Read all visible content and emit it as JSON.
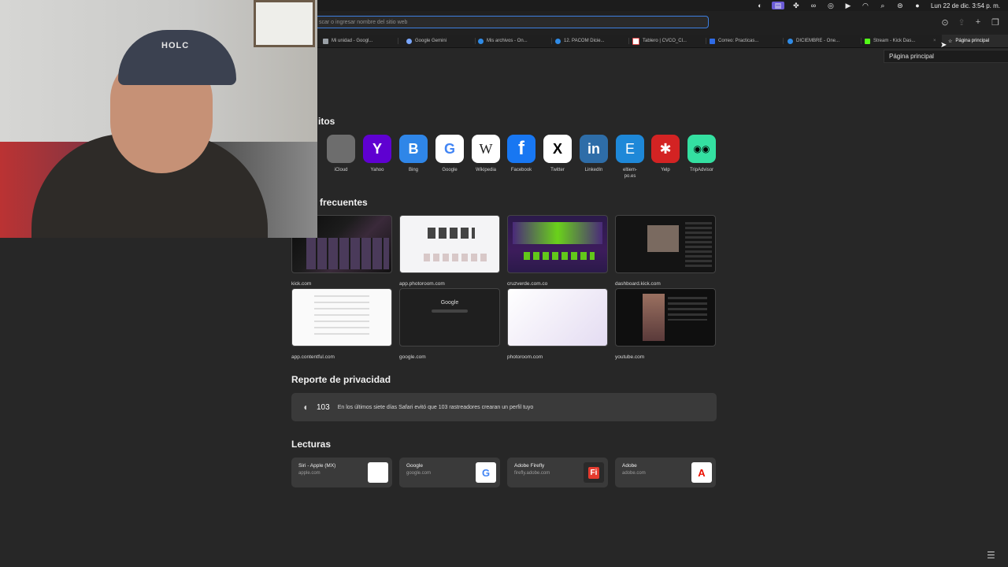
{
  "menubar": {
    "icons": [
      "obs-icon",
      "screen-record-icon",
      "extension-icon",
      "creative-cloud-icon",
      "whatsapp-icon",
      "play-icon",
      "wifi-icon",
      "spotlight-icon",
      "control-center-icon",
      "siri-icon"
    ],
    "clock": "Lun 22 de dic.  3:54 p. m."
  },
  "toolbar": {
    "address_placeholder": "scar o ingresar nombre del sitio web"
  },
  "tabs": [
    {
      "label": "Mi unidad - Googl...",
      "color": "#9aa0a6"
    },
    {
      "label": "Google Gemini",
      "color": "#7aa7ff"
    },
    {
      "label": "Mis archivos - On...",
      "color": "#2f8be6"
    },
    {
      "label": "12. PACOM Dicie...",
      "color": "#2f8be6"
    },
    {
      "label": "Tablero | CVCO_Cl...",
      "color": "#e04848"
    },
    {
      "label": "Correo: Practicas...",
      "color": "#2f6be6"
    },
    {
      "label": "DICIEMBRE - One...",
      "color": "#2f8be6"
    },
    {
      "label": "Stream - Kick Das...",
      "color": "#53fc18"
    },
    {
      "label": "Página principal",
      "color": "#bdbdbd"
    }
  ],
  "tooltip": "Página principal",
  "favorites": {
    "title": "itos",
    "items": [
      {
        "label": "iCloud",
        "glyph": "",
        "bg": "#6d6d6d"
      },
      {
        "label": "Yahoo",
        "glyph": "Y",
        "bg": "#5f01d1"
      },
      {
        "label": "Bing",
        "glyph": "B",
        "bg": "#2f86e8"
      },
      {
        "label": "Google",
        "glyph": "G",
        "bg": "#ffffff"
      },
      {
        "label": "Wikipedia",
        "glyph": "W",
        "bg": "#ffffff"
      },
      {
        "label": "Facebook",
        "glyph": "f",
        "bg": "#1877f2"
      },
      {
        "label": "Twitter",
        "glyph": "X",
        "bg": "#ffffff"
      },
      {
        "label": "LinkedIn",
        "glyph": "in",
        "bg": "#2e6da8"
      },
      {
        "label": "eltiem-\npo.es",
        "glyph": "E",
        "bg": "#1e88d8"
      },
      {
        "label": "Yelp",
        "glyph": "✱",
        "bg": "#d32323"
      },
      {
        "label": "TripAdvisor",
        "glyph": "◉◉",
        "bg": "#34e0a1"
      }
    ]
  },
  "frequent": {
    "title": "frecuentes",
    "items": [
      {
        "caption": "kick.com",
        "theme": "dark"
      },
      {
        "caption": "app.photoroom.com",
        "theme": "light"
      },
      {
        "caption": "cruzverde.com.co",
        "theme": "purple"
      },
      {
        "caption": "dashboard.kick.com",
        "theme": "dark2"
      },
      {
        "caption": "app.contentful.com",
        "theme": "white"
      },
      {
        "caption": "google.com",
        "theme": "google"
      },
      {
        "caption": "photoroom.com",
        "theme": "lavender"
      },
      {
        "caption": "youtube.com",
        "theme": "black"
      }
    ],
    "google_text": "Google"
  },
  "privacy": {
    "title": "Reporte de privacidad",
    "count": "103",
    "text": "En los últimos siete días Safari evitó que 103 rastreadores crearan un perfil tuyo"
  },
  "readings": {
    "title": "Lecturas",
    "items": [
      {
        "title": "Siri - Apple (MX)",
        "url": "apple.com",
        "glyph": "",
        "bg": "#ffffff",
        "fg": "#333333"
      },
      {
        "title": "Google",
        "url": "google.com",
        "glyph": "G",
        "bg": "#ffffff",
        "fg": "#4285f4"
      },
      {
        "title": "Adobe Firefly",
        "url": "firefly.adobe.com",
        "glyph": "Fi",
        "bg": "#3a3a3a",
        "fg": "#ff3b3b"
      },
      {
        "title": "Adobe",
        "url": "adobe.com",
        "glyph": "A",
        "bg": "#ffffff",
        "fg": "#eb1000"
      }
    ]
  },
  "webcam": {
    "cap_brand": "HOLC"
  }
}
